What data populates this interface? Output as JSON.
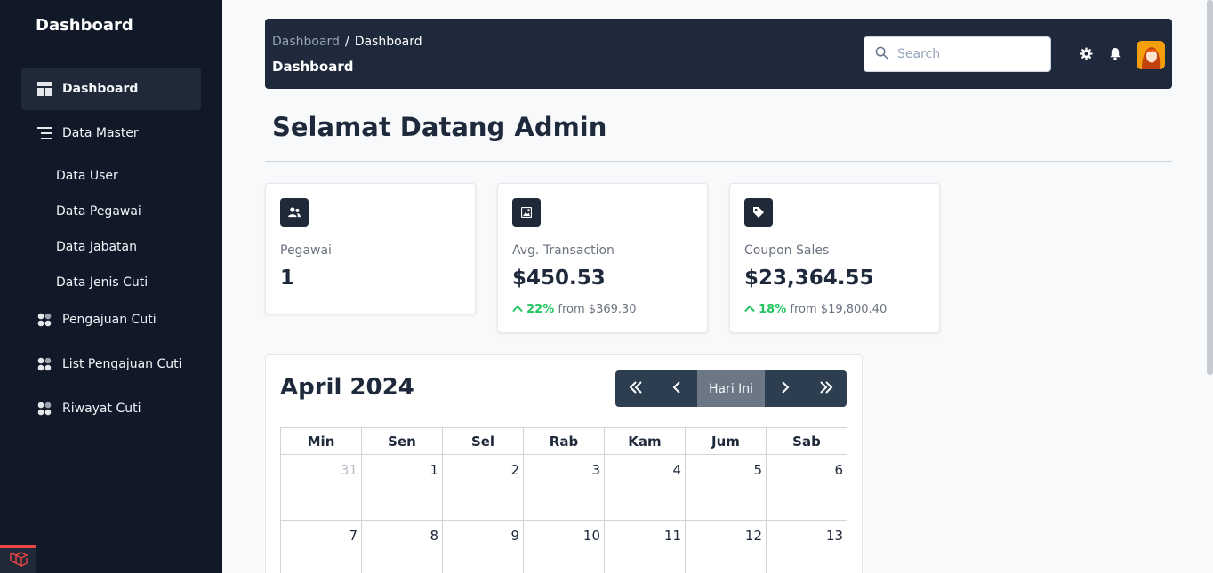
{
  "sidebar": {
    "brand": "Dashboard",
    "items": [
      {
        "label": "Dashboard",
        "icon": "layout-icon"
      },
      {
        "label": "Data Master",
        "icon": "menu-lines-icon"
      },
      {
        "label": "Pengajuan Cuti",
        "icon": "dots-grid-icon"
      },
      {
        "label": "List Pengajuan Cuti",
        "icon": "dots-grid-icon"
      },
      {
        "label": "Riwayat Cuti",
        "icon": "dots-grid-icon"
      }
    ],
    "sub_items": [
      "Data User",
      "Data Pegawai",
      "Data Jabatan",
      "Data Jenis Cuti"
    ]
  },
  "header": {
    "breadcrumb": [
      "Dashboard",
      "Dashboard"
    ],
    "breadcrumb_sep": "/",
    "title": "Dashboard",
    "search_placeholder": "Search"
  },
  "welcome": "Selamat Datang Admin",
  "cards": [
    {
      "label": "Pegawai",
      "value": "1",
      "icon": "users-icon"
    },
    {
      "label": "Avg. Transaction",
      "value": "$450.53",
      "change_pct": "22%",
      "change_from": "from $369.30",
      "icon": "image-icon"
    },
    {
      "label": "Coupon Sales",
      "value": "$23,364.55",
      "change_pct": "18%",
      "change_from": "from $19,800.40",
      "icon": "tag-icon"
    }
  ],
  "calendar": {
    "title": "April 2024",
    "buttons": {
      "first": "«",
      "prev": "‹",
      "today": "Hari Ini",
      "next": "›",
      "last": "»"
    },
    "weekdays": [
      "Min",
      "Sen",
      "Sel",
      "Rab",
      "Kam",
      "Jum",
      "Sab"
    ],
    "weeks": [
      [
        "31",
        "1",
        "2",
        "3",
        "4",
        "5",
        "6"
      ],
      [
        "7",
        "8",
        "9",
        "10",
        "11",
        "12",
        "13"
      ]
    ]
  },
  "colors": {
    "sidebar_bg": "#111827",
    "header_bg": "#1e293b",
    "positive": "#22c55e",
    "laravel_red": "#ef4444"
  }
}
